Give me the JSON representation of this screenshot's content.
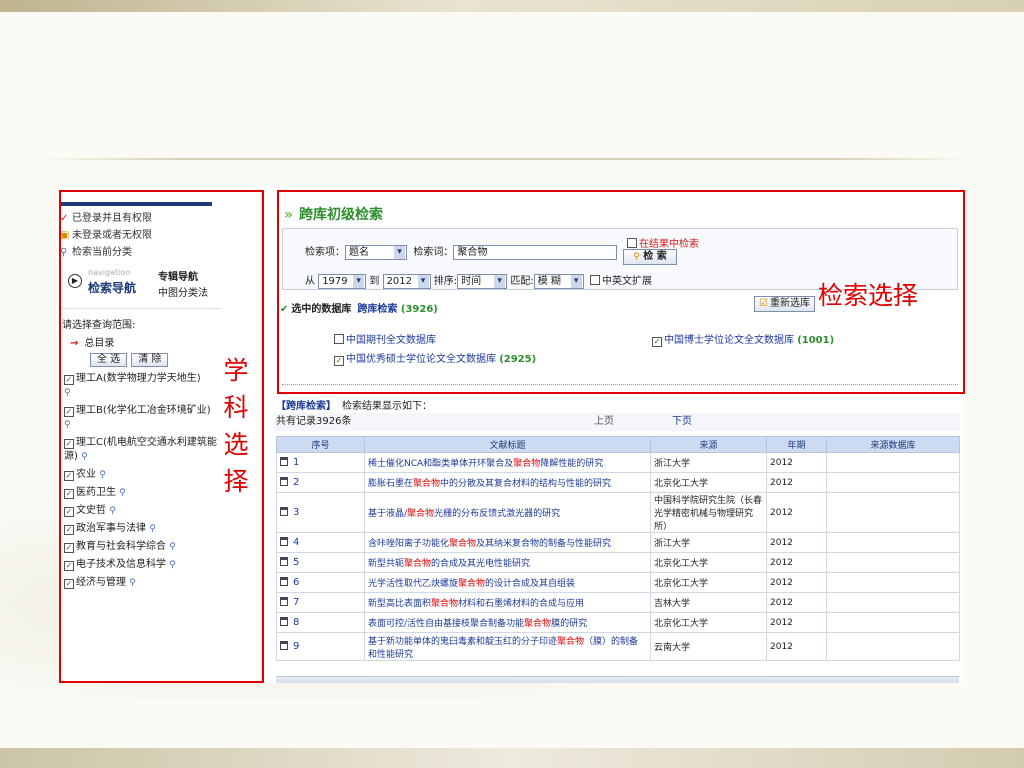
{
  "left": {
    "status": [
      {
        "mark": "✓",
        "text": "已登录并且有权限"
      },
      {
        "mark": "🔒",
        "text": "未登录或者无权限"
      },
      {
        "mark": "🔍",
        "text": "检索当前分类"
      }
    ],
    "nav_small": "navigation",
    "nav_big": "检索导航",
    "nav_r1": "专辑导航",
    "nav_r2": "中图分类法",
    "scope_title": "请选择查询范围:",
    "root_label": "总目录",
    "select_all": "全 选",
    "clear": "清 除",
    "subjects": [
      "理工A(数学物理力学天地生)",
      "理工B(化学化工冶金环境矿业)",
      "理工C(机电航空交通水利建筑能源)",
      "农业",
      "医药卫生",
      "文史哲",
      "政治军事与法律",
      "教育与社会科学综合",
      "电子技术及信息科学",
      "经济与管理"
    ]
  },
  "annotations": {
    "vertical": [
      "学",
      "科",
      "选",
      "择"
    ],
    "horizontal": "检索选择"
  },
  "search": {
    "title": "跨库初级检索",
    "field_label": "检索项：",
    "field_value": "题名",
    "keyword_label": "检索词：",
    "keyword_value": "聚合物",
    "in_results": "在结果中检索",
    "search_button": "检 索",
    "from_label": "从",
    "from_year": "1979",
    "to_label": "到",
    "to_year": "2012",
    "sort_label": "排序:",
    "sort_value": "时间",
    "match_label": "匹配:",
    "match_value": "模 糊",
    "cn_en_expand": "中英文扩展"
  },
  "databases": {
    "label": "选中的数据库",
    "cross": "跨库检索",
    "cross_count": "(3926)",
    "reselect": "重新选库",
    "items": [
      {
        "name": "中国期刊全文数据库",
        "count": "",
        "checked": false
      },
      {
        "name": "中国博士学位论文全文数据库",
        "count": "(1001)",
        "checked": true
      },
      {
        "name": "中国优秀硕士学位论文全文数据库",
        "count": "(2925)",
        "checked": true
      }
    ]
  },
  "results": {
    "header_tag": "【跨库检索】",
    "header_text": "检索结果显示如下：",
    "total": "共有记录3926条",
    "prev": "上页",
    "next": "下页",
    "columns": [
      "序号",
      "文献标题",
      "来源",
      "年期",
      "来源数据库"
    ],
    "rows": [
      {
        "no": "1",
        "title": [
          "稀土催化NCA和酯类单体开环聚合及",
          "聚合物",
          "降解性能的研究"
        ],
        "source": "浙江大学",
        "year": "2012"
      },
      {
        "no": "2",
        "title": [
          "膨胀石墨在",
          "聚合物",
          "中的分散及其复合材料的结构与性能的研究"
        ],
        "source": "北京化工大学",
        "year": "2012"
      },
      {
        "no": "3",
        "title": [
          "基于液晶/",
          "聚合物",
          "光栅的分布反馈式激光器的研究"
        ],
        "source": "中国科学院研究生院（长春光学精密机械与物理研究所）",
        "year": "2012"
      },
      {
        "no": "4",
        "title": [
          "含咔唑阳离子功能化",
          "聚合物",
          "及其纳米复合物的制备与性能研究"
        ],
        "source": "浙江大学",
        "year": "2012"
      },
      {
        "no": "5",
        "title": [
          "新型共轭",
          "聚合物",
          "的合成及其光电性能研究"
        ],
        "source": "北京化工大学",
        "year": "2012"
      },
      {
        "no": "6",
        "title": [
          "光学活性取代乙炔螺旋",
          "聚合物",
          "的设计合成及其自组装"
        ],
        "source": "北京化工大学",
        "year": "2012"
      },
      {
        "no": "7",
        "title": [
          "新型高比表面积",
          "聚合物",
          "材料和石墨烯材料的合成与应用"
        ],
        "source": "吉林大学",
        "year": "2012"
      },
      {
        "no": "8",
        "title": [
          "表面可控/活性自由基接枝聚合制备功能",
          "聚合物",
          "膜的研究"
        ],
        "source": "北京化工大学",
        "year": "2012"
      },
      {
        "no": "9",
        "title": [
          "基于新功能单体的鬼臼毒素和靛玉红的分子印迹",
          "聚合物",
          "（膜）的制备和性能研究"
        ],
        "source": "云南大学",
        "year": "2012"
      }
    ]
  }
}
